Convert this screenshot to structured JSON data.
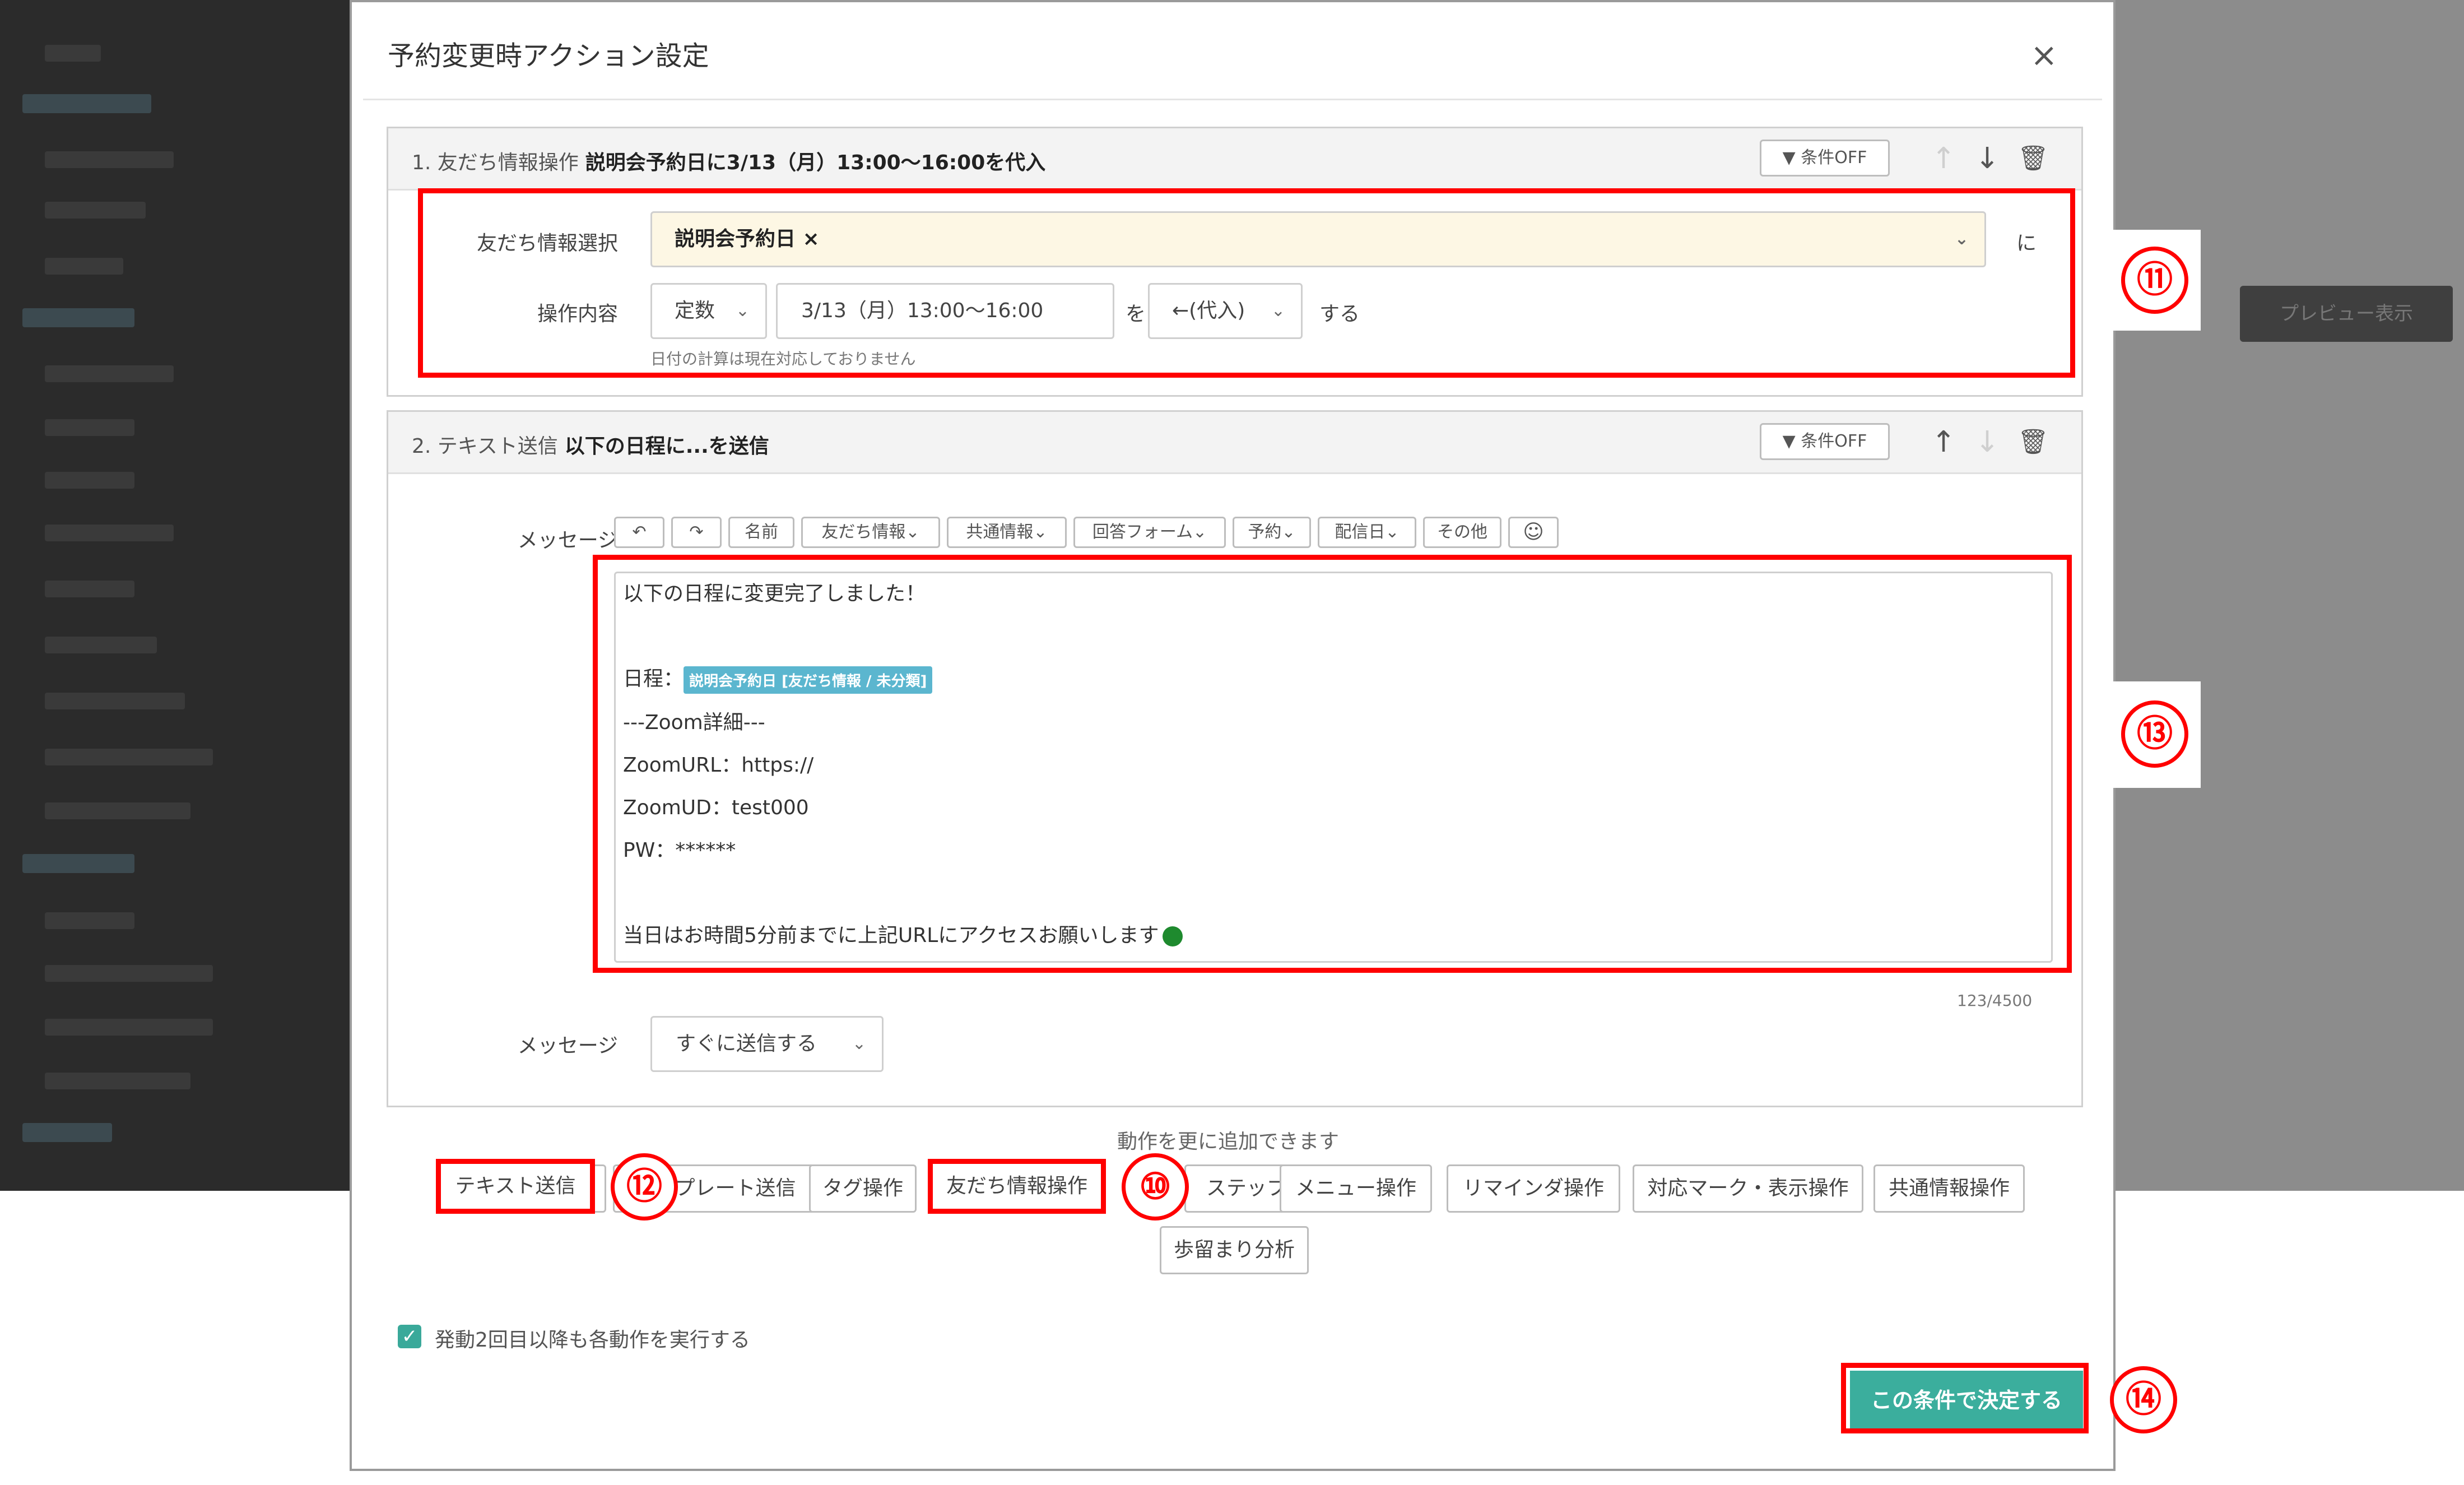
{
  "dialog": {
    "title": "予約変更時アクション設定",
    "close_glyph": "×"
  },
  "card1": {
    "index": "1. 友だち情報操作",
    "summary": "説明会予約日に3/13（月）13:00〜16:00を代入",
    "condition_btn": "条件OFF",
    "friend_label": "友だち情報選択",
    "friend_value": "説明会予約日 ×",
    "suffix_ni": "に",
    "op_label": "操作内容",
    "op_type": "定数",
    "op_value": "3/13（月）13:00〜16:00",
    "suffix_wo": "を",
    "op_mode": "←(代入)",
    "suffix_suru": "する",
    "note": "日付の計算は現在対応しておりません"
  },
  "card2": {
    "index": "2. テキスト送信",
    "summary": "以下の日程に...を送信",
    "condition_btn": "条件OFF",
    "message_label": "メッセージ",
    "toolbar": [
      "↶",
      "↷",
      "名前",
      "友だち情報⌄",
      "共通情報⌄",
      "回答フォーム⌄",
      "予約⌄",
      "配信日⌄",
      "その他",
      "☺"
    ],
    "message_lines": {
      "l1": "以下の日程に変更完了しました！",
      "l2_prefix": "日程：",
      "l2_tag": "説明会予約日 [友だち情報 / 未分類]",
      "l3": "---Zoom詳細---",
      "l4": "ZoomURL：https://",
      "l5": "ZoomUD：test000",
      "l6": "PW：******",
      "l7": "当日はお時間5分前までに上記URLにアクセスお願いします"
    },
    "counter": "123/4500",
    "timing_label": "メッセージ",
    "timing_value": "すぐに送信する"
  },
  "add_actions": {
    "hint": "動作を更に追加できます",
    "buttons": [
      "テキスト送信",
      "テンプレート送信",
      "タグ操作",
      "友だち情報操作",
      "ステップ配信操作",
      "メニュー操作",
      "リマインダ操作",
      "対応マーク・表示操作",
      "共通情報操作",
      "歩留まり分析"
    ]
  },
  "repeat_checkbox": {
    "label": "発動2回目以降も各動作を実行する",
    "checked": true
  },
  "submit_label": "この条件で決定する",
  "annotations": {
    "n10": "⑩",
    "n11": "⑪",
    "n12": "⑫",
    "n13": "⑬",
    "n14": "⑭"
  },
  "background": {
    "preview_btn": "プレビュー表示"
  },
  "colors": {
    "accent": "#3bae9d",
    "highlight_red": "#ff0000",
    "field_highlight": "#fdf7e4",
    "tag_chip": "#5bb6cf"
  }
}
